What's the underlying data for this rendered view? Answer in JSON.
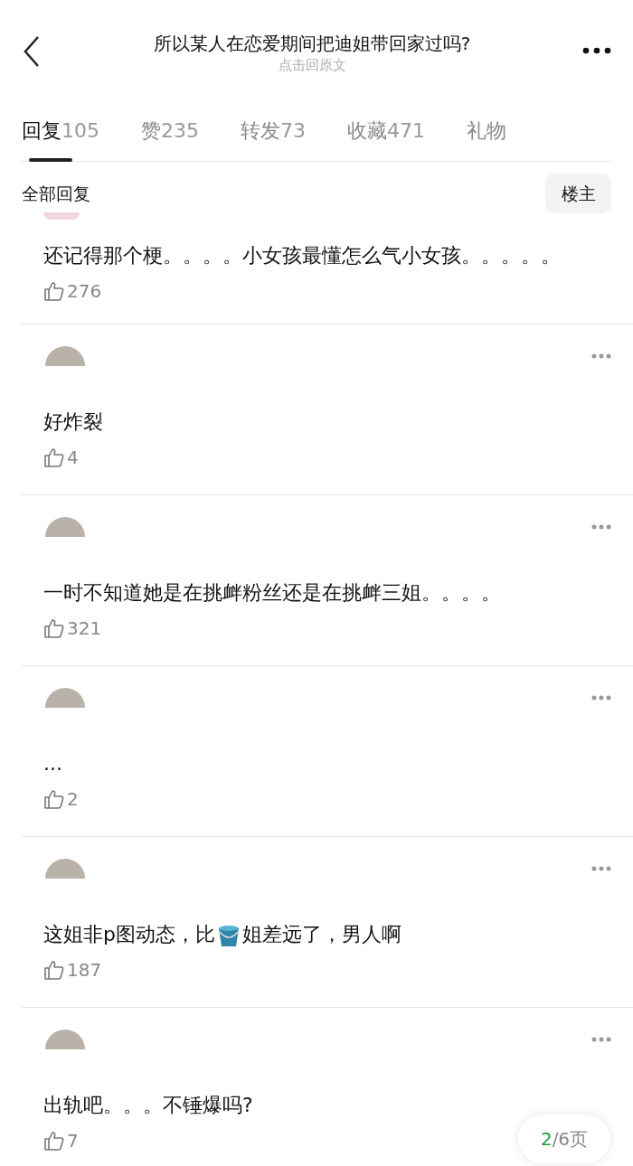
{
  "header": {
    "title": "所以某人在恋爱期间把迪姐带回家过吗?",
    "subtitle": "点击回原文"
  },
  "tabs": [
    {
      "label": "回复",
      "count": "105",
      "selected": true
    },
    {
      "label": "赞",
      "count": "235",
      "selected": false
    },
    {
      "label": "转发",
      "count": "73",
      "selected": false
    },
    {
      "label": "收藏",
      "count": "471",
      "selected": false
    },
    {
      "label": "礼物",
      "selected": false
    }
  ],
  "filter": {
    "label": "全部回复",
    "button": "楼主"
  },
  "comments": [
    {
      "cut_top": true,
      "parts": [
        {
          "kind": "text",
          "text": "还记得那个梗。。。。小女孩最懂怎么气小女孩。。。。。"
        }
      ],
      "likes": "276"
    },
    {
      "cut_top": false,
      "parts": [
        {
          "kind": "text",
          "text": "好炸裂"
        }
      ],
      "likes": "4"
    },
    {
      "cut_top": false,
      "parts": [
        {
          "kind": "text",
          "text": "一时不知道她是在挑衅粉丝还是在挑衅三姐。。。。"
        }
      ],
      "likes": "321"
    },
    {
      "cut_top": false,
      "parts": [
        {
          "kind": "text",
          "text": "..."
        }
      ],
      "likes": "2"
    },
    {
      "cut_top": false,
      "parts": [
        {
          "kind": "text",
          "text": "这姐非p图动态，比"
        },
        {
          "kind": "emoji"
        },
        {
          "kind": "text",
          "text": "姐差远了，男人啊"
        }
      ],
      "likes": "187"
    },
    {
      "cut_top": false,
      "parts": [
        {
          "kind": "text",
          "text": "出轨吧。。。不锤爆吗?"
        }
      ],
      "likes": "7"
    }
  ],
  "pager": {
    "current": "2",
    "total": "/6页"
  }
}
